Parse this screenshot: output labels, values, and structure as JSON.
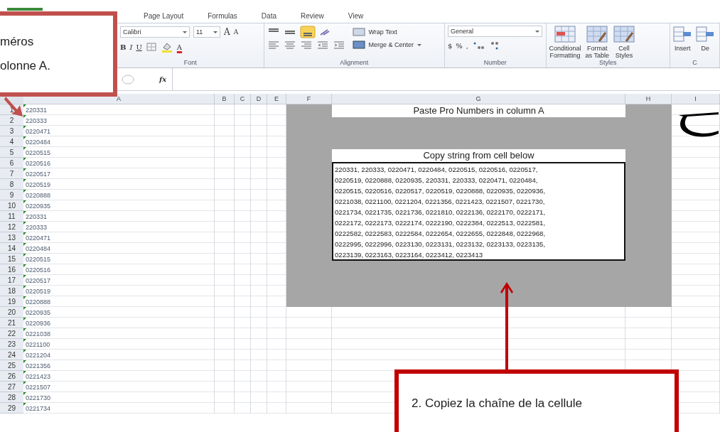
{
  "tabs": [
    {
      "label": "Page Layout",
      "selected": false
    },
    {
      "label": "Formulas",
      "selected": false
    },
    {
      "label": "Data",
      "selected": false
    },
    {
      "label": "Review",
      "selected": false
    },
    {
      "label": "View",
      "selected": false
    }
  ],
  "ribbon": {
    "font_group": {
      "label": "Font",
      "font_name": "Calibri",
      "font_size": "11",
      "grow_font": "A",
      "shrink_font": "A",
      "bold": "B",
      "italic": "I",
      "underline": "U",
      "font_color": "A"
    },
    "alignment_group": {
      "label": "Alignment",
      "wrap_text": "Wrap Text",
      "merge_center": "Merge & Center"
    },
    "number_group": {
      "label": "Number",
      "format": "General",
      "currency": "$",
      "percent": "%",
      "comma": ","
    },
    "styles_group": {
      "label": "Styles",
      "buttons": [
        "Conditional\nFormatting",
        "Format\nas Table",
        "Cell\nStyles"
      ]
    },
    "cells_group": {
      "label": "C",
      "buttons": [
        "Insert",
        "De"
      ]
    }
  },
  "formula_bar": {
    "function_label": "fx"
  },
  "columns": [
    "A",
    "B",
    "C",
    "D",
    "E",
    "F",
    "G",
    "H",
    "I"
  ],
  "rows": [
    {
      "number": "1",
      "value": "220331"
    },
    {
      "number": "2",
      "value": "220333"
    },
    {
      "number": "3",
      "value": "0220471"
    },
    {
      "number": "4",
      "value": "0220484"
    },
    {
      "number": "5",
      "value": "0220515"
    },
    {
      "number": "6",
      "value": "0220516"
    },
    {
      "number": "7",
      "value": "0220517"
    },
    {
      "number": "8",
      "value": "0220519"
    },
    {
      "number": "9",
      "value": "0220888"
    },
    {
      "number": "10",
      "value": "0220935"
    },
    {
      "number": "11",
      "value": "220331"
    },
    {
      "number": "12",
      "value": "220333"
    },
    {
      "number": "13",
      "value": "0220471"
    },
    {
      "number": "14",
      "value": "0220484"
    },
    {
      "number": "15",
      "value": "0220515"
    },
    {
      "number": "16",
      "value": "0220516"
    },
    {
      "number": "17",
      "value": "0220517"
    },
    {
      "number": "18",
      "value": "0220519"
    },
    {
      "number": "19",
      "value": "0220888"
    },
    {
      "number": "20",
      "value": "0220935"
    },
    {
      "number": "21",
      "value": "0220936"
    },
    {
      "number": "22",
      "value": "0221038"
    },
    {
      "number": "23",
      "value": "0221100"
    },
    {
      "number": "24",
      "value": "0221204"
    },
    {
      "number": "25",
      "value": "0221356"
    },
    {
      "number": "26",
      "value": "0221423"
    },
    {
      "number": "27",
      "value": "0221507"
    },
    {
      "number": "28",
      "value": "0221730"
    },
    {
      "number": "29",
      "value": "0221734"
    }
  ],
  "sheet": {
    "title": "Paste Pro Numbers in column A",
    "copy_label": "Copy string from cell below",
    "string_lines": [
      "220331, 220333, 0220471, 0220484, 0220515, 0220516, 0220517,",
      "0220519, 0220888, 0220935, 220331, 220333, 0220471, 0220484,",
      "0220515, 0220516, 0220517, 0220519, 0220888, 0220935, 0220936,",
      "0221038, 0221100, 0221204, 0221356, 0221423, 0221507, 0221730,",
      "0221734, 0221735, 0221736, 0221810, 0222136, 0222170, 0222171,",
      "0222172, 0222173, 0222174, 0222190, 0222384, 0222513, 0222581,",
      "0222582, 0222583, 0222584, 0222654, 0222655, 0222848, 0222968,",
      "0222995, 0222996, 0223130, 0223131, 0223132, 0223133, 0223135,",
      "0223139, 0223163, 0223164, 0223412, 0223413"
    ]
  },
  "callouts": [
    {
      "lines": [
        "méros",
        "olonne A."
      ]
    },
    {
      "lines": [
        "2. Copiez la chaîne de la cellule"
      ]
    }
  ]
}
